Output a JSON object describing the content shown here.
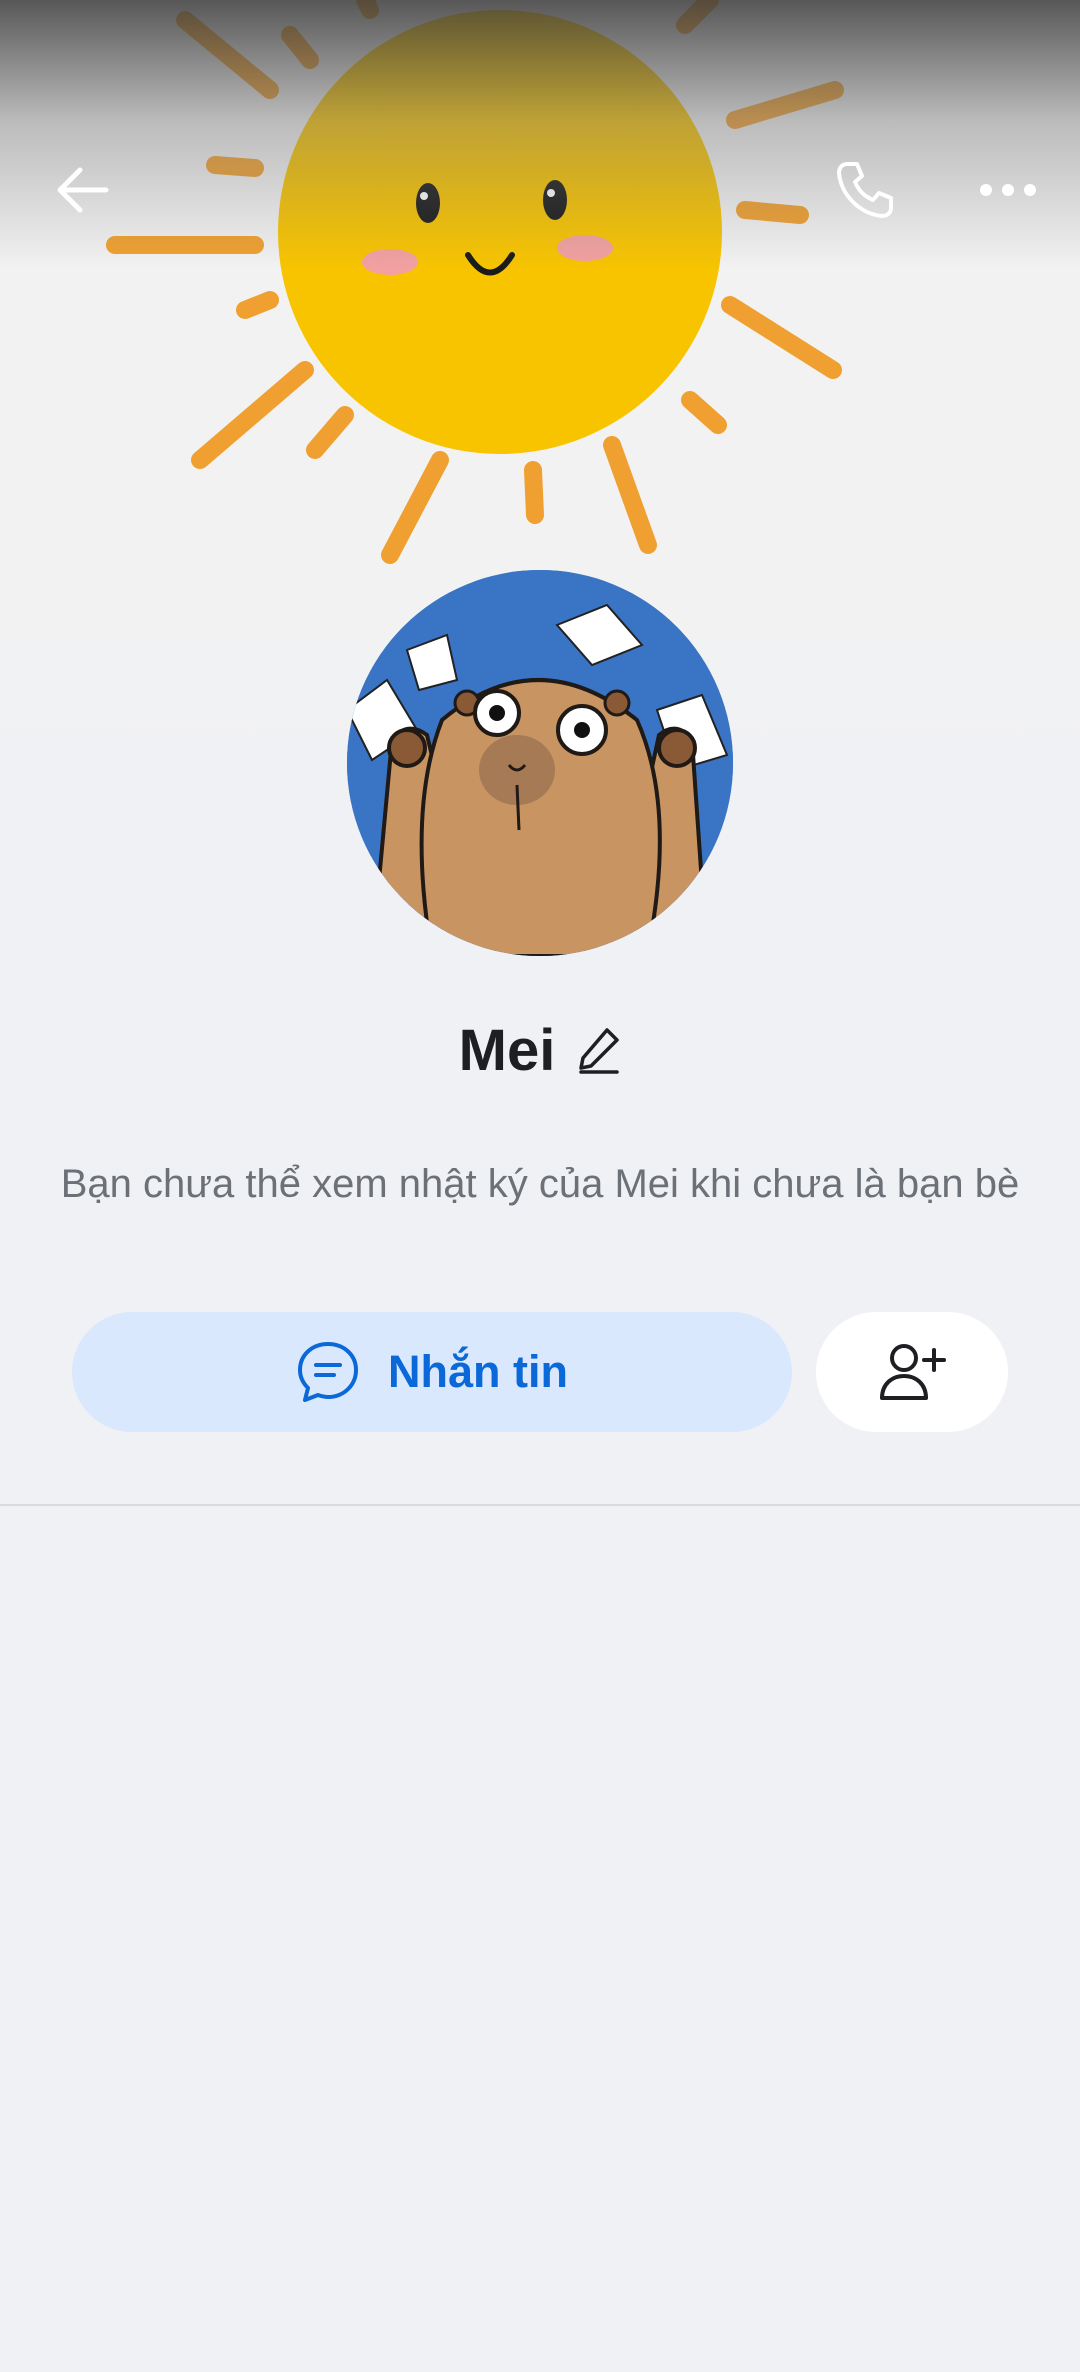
{
  "header": {
    "back_icon": "arrow-left-icon",
    "call_icon": "phone-icon",
    "more_icon": "more-horizontal-icon"
  },
  "profile": {
    "cover_image": "sun-illustration",
    "avatar_image": "capybara-illustration",
    "name": "Mei",
    "edit_icon": "pencil-icon",
    "notice": "Bạn chưa thể xem nhật ký của Mei khi chưa là bạn bè"
  },
  "actions": {
    "message_label": "Nhắn tin",
    "message_icon": "chat-bubble-icon",
    "add_friend_icon": "add-user-icon"
  },
  "colors": {
    "accent": "#0a68d8",
    "message_button_bg": "#d9e8fc",
    "page_bg": "#f0f1f4"
  }
}
